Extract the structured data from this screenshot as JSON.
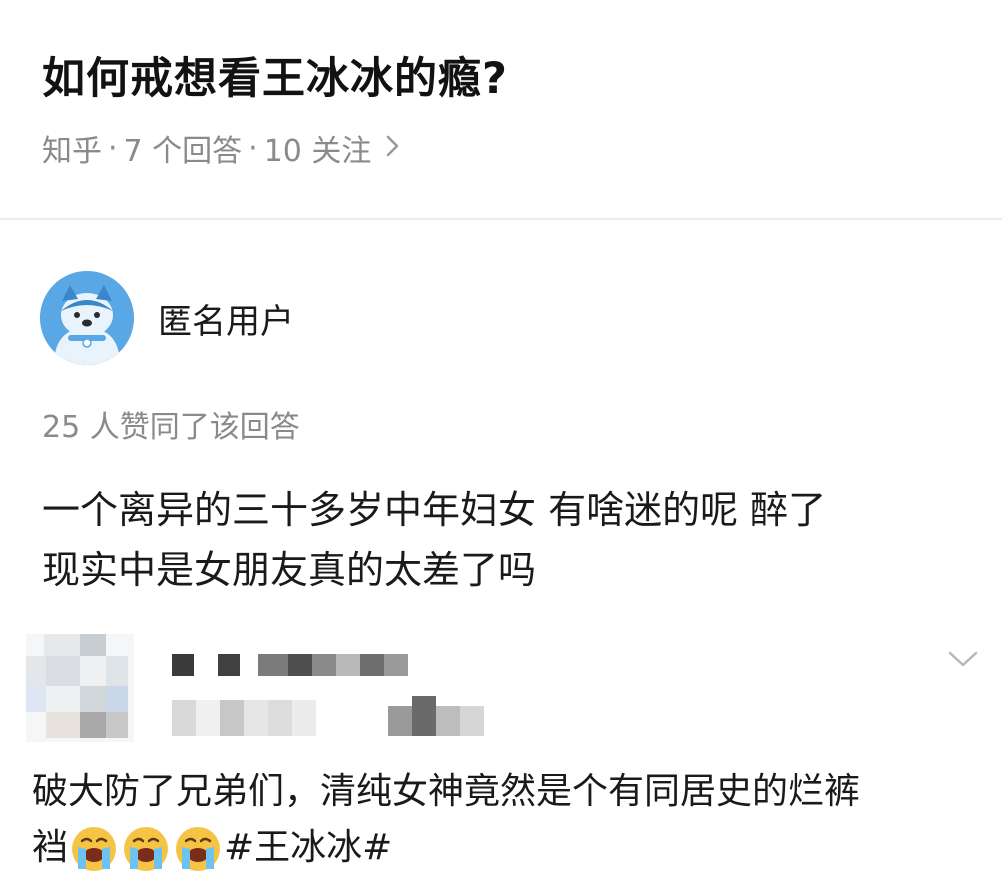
{
  "question": {
    "title": "如何戒想看王冰冰的瘾?",
    "source": "知乎",
    "answers": "7 个回答",
    "follows": "10 关注",
    "chevron_icon": "chevron-right-icon"
  },
  "answer": {
    "author": "匿名用户",
    "votes": "25 人赞同了该回答",
    "body_lines": [
      "一个离异的三十多岁中年妇女 有啥迷的呢 醉了",
      "现实中是女朋友真的太差了吗"
    ]
  },
  "embedded_post": {
    "text_line1": "破大防了兄弟们，清纯女神竟然是个有同居史的烂裤",
    "text_line2_prefix": "裆",
    "emoji_names": [
      "crying-face-emoji",
      "crying-face-emoji",
      "crying-face-emoji"
    ],
    "hashtag": "#王冰冰#",
    "colors": {
      "avatar_blue": "#5aa7e6",
      "emoji_yellow": "#f6c445"
    }
  }
}
